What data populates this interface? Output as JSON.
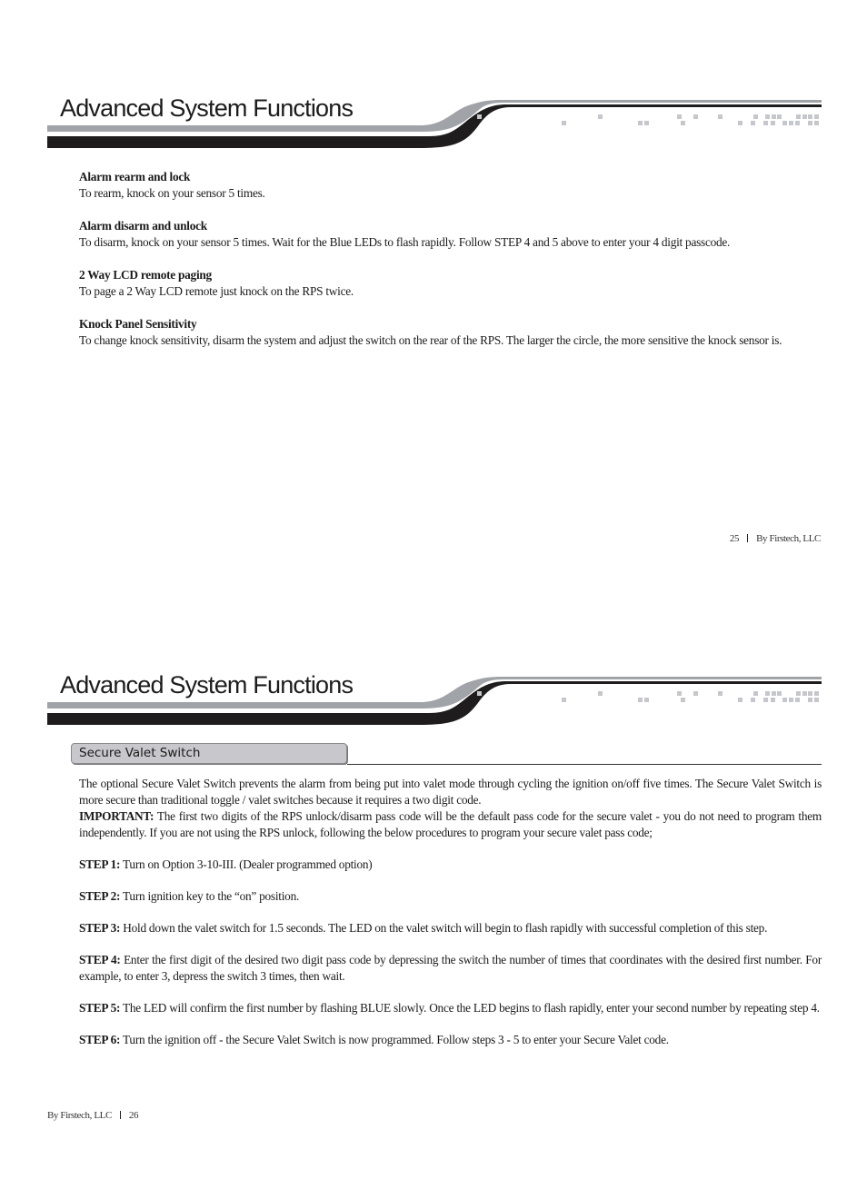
{
  "pages": [
    {
      "header": {
        "title": "Advanced System Functions"
      },
      "sections": [
        {
          "title": "Alarm rearm and lock",
          "body": "To rearm, knock on your sensor 5 times."
        },
        {
          "title": "Alarm disarm and unlock",
          "body": "To disarm, knock on your sensor 5 times. Wait for the Blue LEDs to flash rapidly. Follow STEP 4 and 5 above to enter your 4 digit passcode."
        },
        {
          "title": "2 Way LCD remote paging",
          "body": "To page a 2 Way LCD remote just knock on the RPS twice."
        },
        {
          "title": "Knock Panel Sensitivity",
          "body": "To change knock sensitivity, disarm the system and adjust the switch on the rear of the RPS. The larger the circle, the more sensitive the knock sensor is."
        }
      ],
      "footer": {
        "page_number": "25",
        "company": "By Firstech, LLC"
      }
    },
    {
      "header": {
        "title": "Advanced System Functions"
      },
      "section_tab": "Secure Valet Switch",
      "intro": "The optional Secure Valet Switch prevents the alarm from being put into valet mode through cycling the ignition on/off five times. The Secure Valet Switch is more secure than traditional toggle / valet switches because it requires a two digit code.",
      "important": {
        "label": "IMPORTANT:",
        "text": "The first two digits of the RPS unlock/disarm pass code will be the default pass code for the secure valet - you do not need to program them independently. If you are not using the RPS unlock, following the below procedures to program your secure valet pass code;"
      },
      "steps": [
        {
          "label": "STEP 1:",
          "text": "Turn on Option 3-10-III. (Dealer programmed option)"
        },
        {
          "label": "STEP 2:",
          "text": "Turn ignition key to the “on” position."
        },
        {
          "label": "STEP 3:",
          "text": "Hold down the valet switch for 1.5 seconds. The LED on the valet switch will begin to flash rapidly with successful completion of this step."
        },
        {
          "label": "STEP 4:",
          "text": "Enter the first digit of the desired two digit pass code by depressing the switch the number of times that coordinates with the desired first number. For example, to enter 3, depress the switch 3 times, then wait."
        },
        {
          "label": "STEP 5:",
          "text": "The  LED  will confirm the first number by flashing BLUE slowly. Once the LED begins to flash rapidly, enter your second number by repeating step 4."
        },
        {
          "label": "STEP 6:",
          "text": "Turn the ignition off - the Secure Valet Switch is now programmed. Follow steps 3 - 5 to enter your Secure Valet code."
        }
      ],
      "footer": {
        "company": "By Firstech, LLC",
        "page_number": "26"
      }
    }
  ]
}
